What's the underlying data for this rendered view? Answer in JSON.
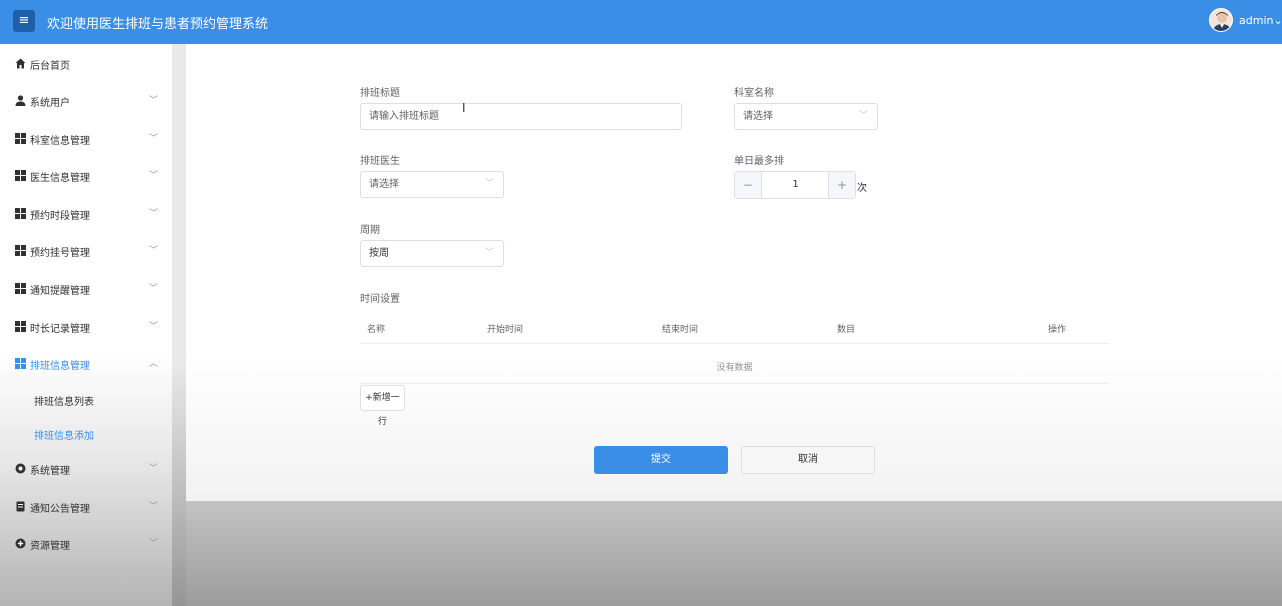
{
  "header": {
    "title": "欢迎使用医生排班与患者预约管理系统",
    "menu_icon": "hamburger-icon",
    "user": "admin",
    "user_chevron": "⌄"
  },
  "sidebar": {
    "items": [
      {
        "label": "后台首页",
        "icon": "home-icon"
      },
      {
        "label": "系统用户",
        "icon": "user-icon"
      },
      {
        "label": "科室信息管理",
        "icon": "grid-icon"
      },
      {
        "label": "医生信息管理",
        "icon": "grid-icon"
      },
      {
        "label": "预约时段管理",
        "icon": "grid-icon"
      },
      {
        "label": "预约挂号管理",
        "icon": "grid-icon"
      },
      {
        "label": "通知提醒管理",
        "icon": "grid-icon"
      },
      {
        "label": "时长记录管理",
        "icon": "grid-icon"
      },
      {
        "label": "排班信息管理",
        "icon": "grid-icon"
      },
      {
        "label": "系统管理",
        "icon": "gear-icon"
      },
      {
        "label": "通知公告管理",
        "icon": "document-icon"
      },
      {
        "label": "资源管理",
        "icon": "plus-circle-icon"
      }
    ],
    "sub_items": [
      {
        "label": "排班信息列表"
      },
      {
        "label": "排班信息添加"
      }
    ]
  },
  "form": {
    "title_label": "排班标题",
    "title_placeholder": "请输入排班标题",
    "dept_label": "科室名称",
    "dept_value": "请选择",
    "doctor_label": "排班医生",
    "doctor_value": "请选择",
    "max_label": "单日最多排",
    "max_value": "1",
    "max_unit": "次",
    "minus": "−",
    "plus": "+",
    "cycle_label": "周期",
    "cycle_value": "按周",
    "time_label": "时间设置"
  },
  "table": {
    "columns": [
      "名称",
      "开始时间",
      "结束时间",
      "数目",
      "操作"
    ],
    "empty_text": "没有数据",
    "add_row": "+新增一行"
  },
  "buttons": {
    "submit": "提交",
    "cancel": "取消"
  },
  "colors": {
    "accent": "#3a8ee6",
    "header_bg": "#3a8ee6"
  }
}
